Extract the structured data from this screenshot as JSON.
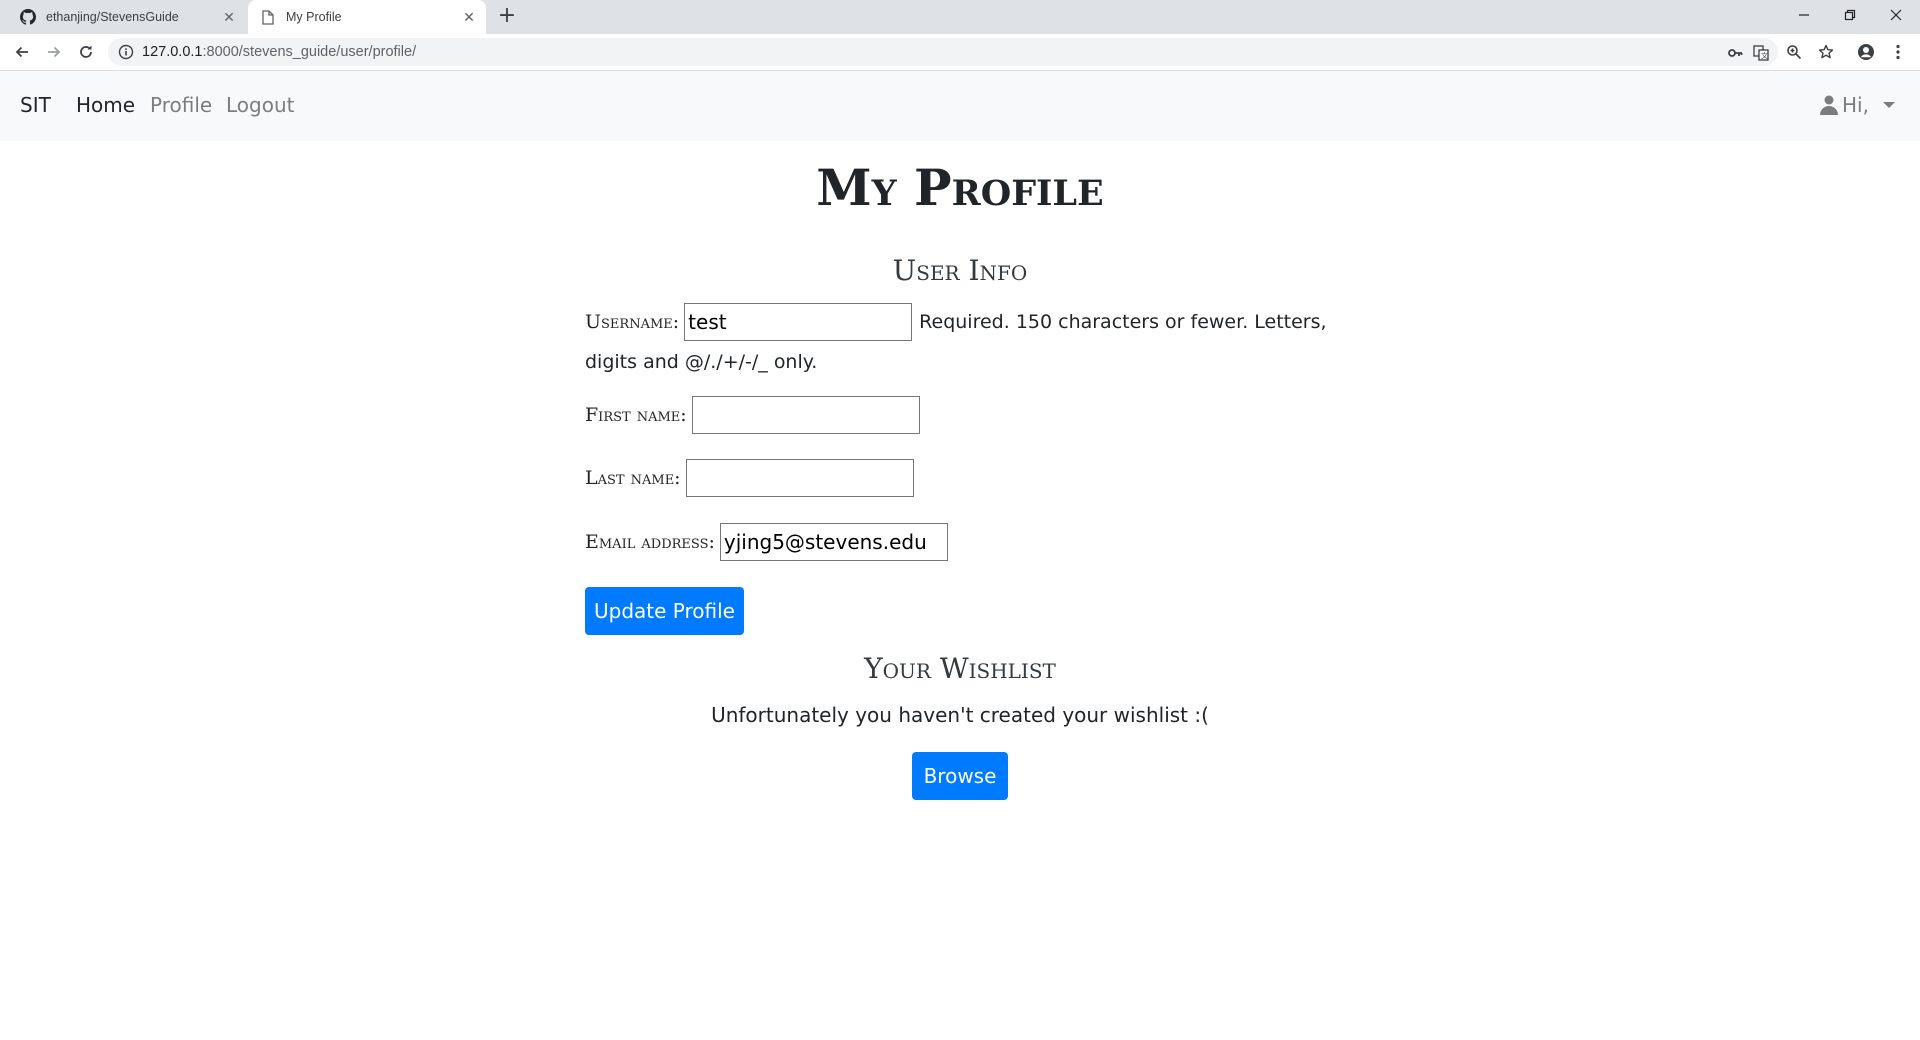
{
  "browser": {
    "tabs": [
      {
        "title": "ethanjing/StevensGuide",
        "icon": "github-icon",
        "active": false
      },
      {
        "title": "My Profile",
        "icon": "document-icon",
        "active": true
      }
    ],
    "url_host": "127.0.0.1",
    "url_rest": ":8000/stevens_guide/user/profile/"
  },
  "navbar": {
    "brand": "SIT",
    "links": [
      {
        "label": "Home",
        "active": true
      },
      {
        "label": "Profile",
        "active": false
      },
      {
        "label": "Logout",
        "active": false
      }
    ],
    "user_greeting": "Hi,"
  },
  "page": {
    "title": "My Profile",
    "user_info": {
      "heading": "User Info",
      "username_label": "Username:",
      "username_value": "test",
      "username_help": "Required. 150 characters or fewer. Letters,",
      "username_help_cont": "digits and @/./+/-/_ only.",
      "first_name_label": "First name:",
      "first_name_value": "",
      "last_name_label": "Last name:",
      "last_name_value": "",
      "email_label": "Email address:",
      "email_value": "yjing5@stevens.edu",
      "update_button": "Update Profile"
    },
    "wishlist": {
      "heading": "Your Wishlist",
      "empty_message": "Unfortunately you haven't created your wishlist :(",
      "browse_button": "Browse"
    }
  },
  "colors": {
    "primary": "#007bff",
    "navbar_bg": "#f8f9fa",
    "tabbar_bg": "#dee1e6"
  }
}
